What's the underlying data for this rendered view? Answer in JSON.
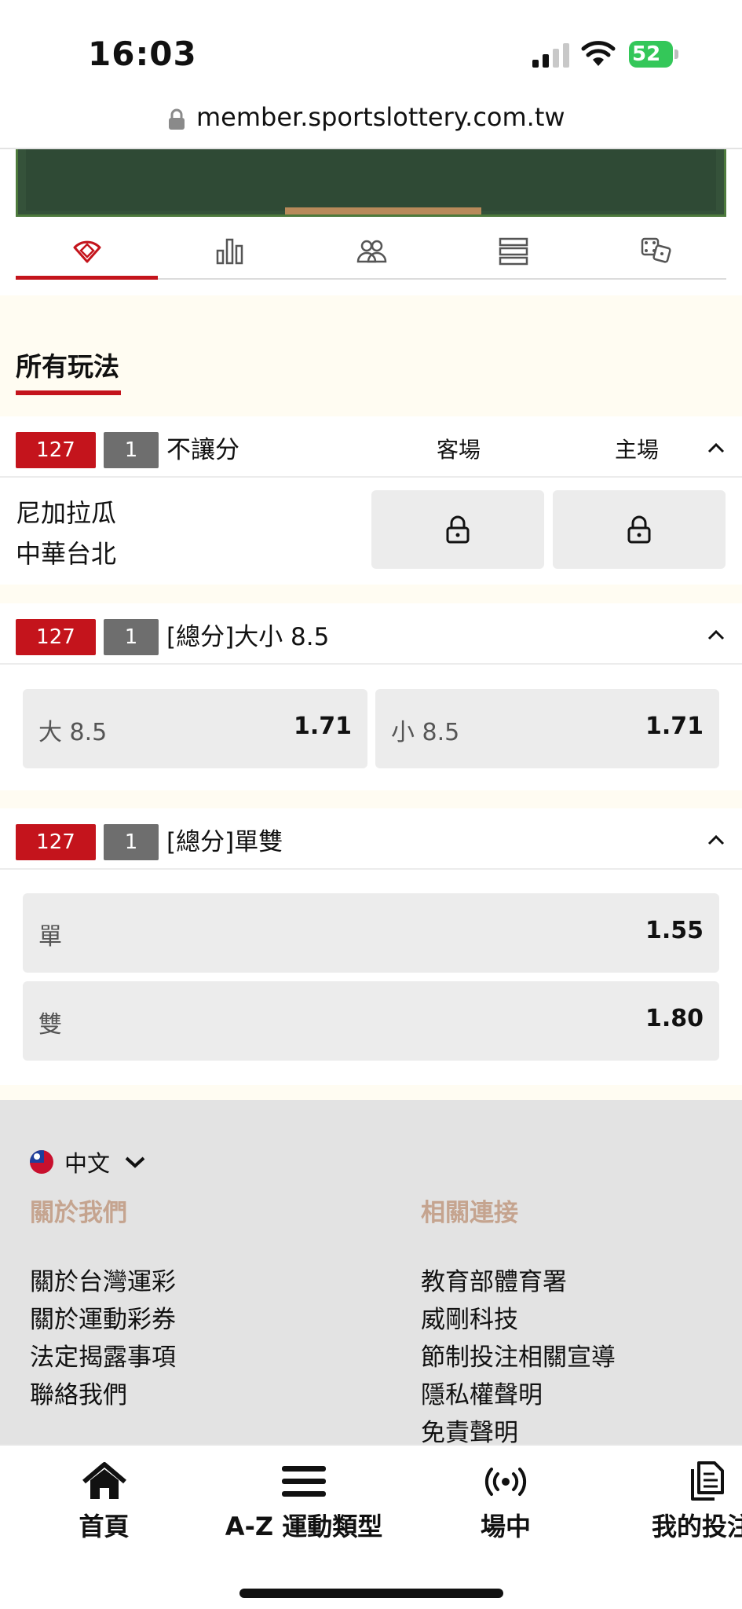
{
  "status": {
    "time": "16:03",
    "battery": "52"
  },
  "browser": {
    "url": "member.sportslottery.com.tw"
  },
  "tabs": [
    {
      "icon": "baseball-field-icon",
      "active": true
    },
    {
      "icon": "bar-chart-icon",
      "active": false
    },
    {
      "icon": "lineup-icon",
      "active": false
    },
    {
      "icon": "list-icon",
      "active": false
    },
    {
      "icon": "dice-icon",
      "active": false
    }
  ],
  "section": {
    "title": "所有玩法"
  },
  "markets": [
    {
      "code": "127",
      "num": "1",
      "title": "不讓分",
      "col_away": "客場",
      "col_home": "主場",
      "teams": [
        "尼加拉瓜",
        "中華台北"
      ],
      "locked": true
    },
    {
      "code": "127",
      "num": "1",
      "title": "[總分]大小 8.5",
      "selections": [
        {
          "label": "大 8.5",
          "odds": "1.71"
        },
        {
          "label": "小 8.5",
          "odds": "1.71"
        }
      ]
    },
    {
      "code": "127",
      "num": "1",
      "title": "[總分]單雙",
      "selections": [
        {
          "label": "單",
          "odds": "1.55"
        },
        {
          "label": "雙",
          "odds": "1.80"
        }
      ]
    }
  ],
  "footer": {
    "language": "中文",
    "about": {
      "heading": "關於我們",
      "links": [
        "關於台灣運彩",
        "關於運動彩券",
        "法定揭露事項",
        "聯絡我們"
      ]
    },
    "related": {
      "heading": "相關連接",
      "links": [
        "教育部體育署",
        "威剛科技",
        "節制投注相關宣導",
        "隱私權聲明",
        "免責聲明"
      ]
    }
  },
  "bottom_nav": [
    {
      "label": "首頁",
      "icon": "home-icon"
    },
    {
      "label": "A-Z 運動類型",
      "icon": "menu-icon"
    },
    {
      "label": "場中",
      "icon": "live-icon"
    },
    {
      "label": "我的投注",
      "icon": "bets-icon"
    }
  ],
  "colors": {
    "accent": "#c4141c",
    "badge_gray": "#6e6e6e",
    "footer_heading": "#c5a48f"
  }
}
